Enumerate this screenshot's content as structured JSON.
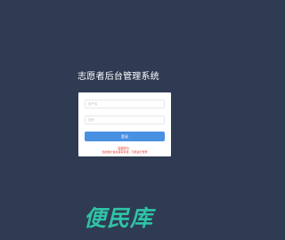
{
  "page": {
    "title": "志愿者后台管理系统"
  },
  "login": {
    "username_placeholder": "用户名",
    "password_placeholder": "密码",
    "submit_label": "登录",
    "error_title": "温馨提示：",
    "error_message": "您的账户信息填写有误，不能进行登录"
  },
  "watermark": {
    "text": "便民库"
  },
  "colors": {
    "background": "#2f3b52",
    "primary": "#4a90e2",
    "error": "#e0362c",
    "watermark": "#2ec4a6"
  }
}
